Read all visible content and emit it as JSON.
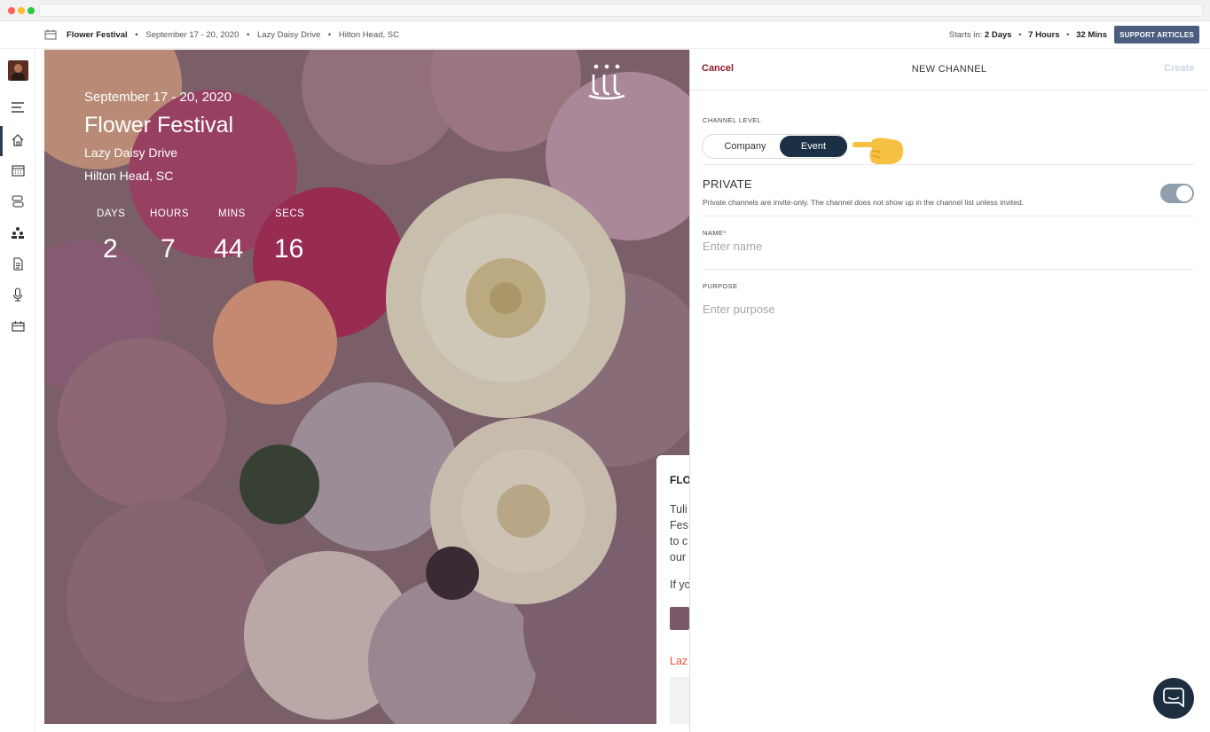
{
  "topbar": {
    "event_name": "Flower Festival",
    "dates": "September 17 - 20, 2020",
    "venue": "Lazy Daisy Drive",
    "city": "Hilton Head, SC",
    "sep": "•",
    "starts_label": "Starts in:",
    "starts_days": "2 Days",
    "starts_hours": "7 Hours",
    "starts_mins": "32 Mins",
    "support_label": "SUPPORT ARTICLES"
  },
  "sidebar": {
    "items": [
      "menu-icon",
      "home-icon",
      "calendar-icon",
      "agenda-icon",
      "people-icon",
      "document-icon",
      "microphone-icon",
      "ticket-icon"
    ]
  },
  "hero": {
    "date": "September 17 - 20, 2020",
    "title": "Flower Festival",
    "location_line1": "Lazy Daisy Drive",
    "location_line2": "Hilton Head, SC",
    "countdown": {
      "days_label": "DAYS",
      "days": "2",
      "hours_label": "HOURS",
      "hours": "7",
      "mins_label": "MINS",
      "mins": "44",
      "secs_label": "SECS",
      "secs": "16"
    }
  },
  "card": {
    "title": "FLO",
    "lines": [
      "Tuli",
      "Fes",
      "to c",
      "our"
    ],
    "line5": "If yo",
    "link": "Laz"
  },
  "panel": {
    "cancel": "Cancel",
    "title": "NEW CHANNEL",
    "create": "Create",
    "channel_level_label": "CHANNEL LEVEL",
    "level_company": "Company",
    "level_event": "Event",
    "level_selected": "Event",
    "private_title": "PRIVATE",
    "private_desc": "Private channels are invite-only. The channel does not show up in the channel list unless invited.",
    "private_on": true,
    "name_label": "NAME*",
    "name_placeholder": "Enter name",
    "name_value": "",
    "purpose_label": "PURPOSE",
    "purpose_placeholder": "Enter purpose",
    "purpose_value": ""
  },
  "colors": {
    "accent": "#1b2f45",
    "cancel": "#8b1a27",
    "support_button": "#4b5e80",
    "link": "#e5543b"
  }
}
